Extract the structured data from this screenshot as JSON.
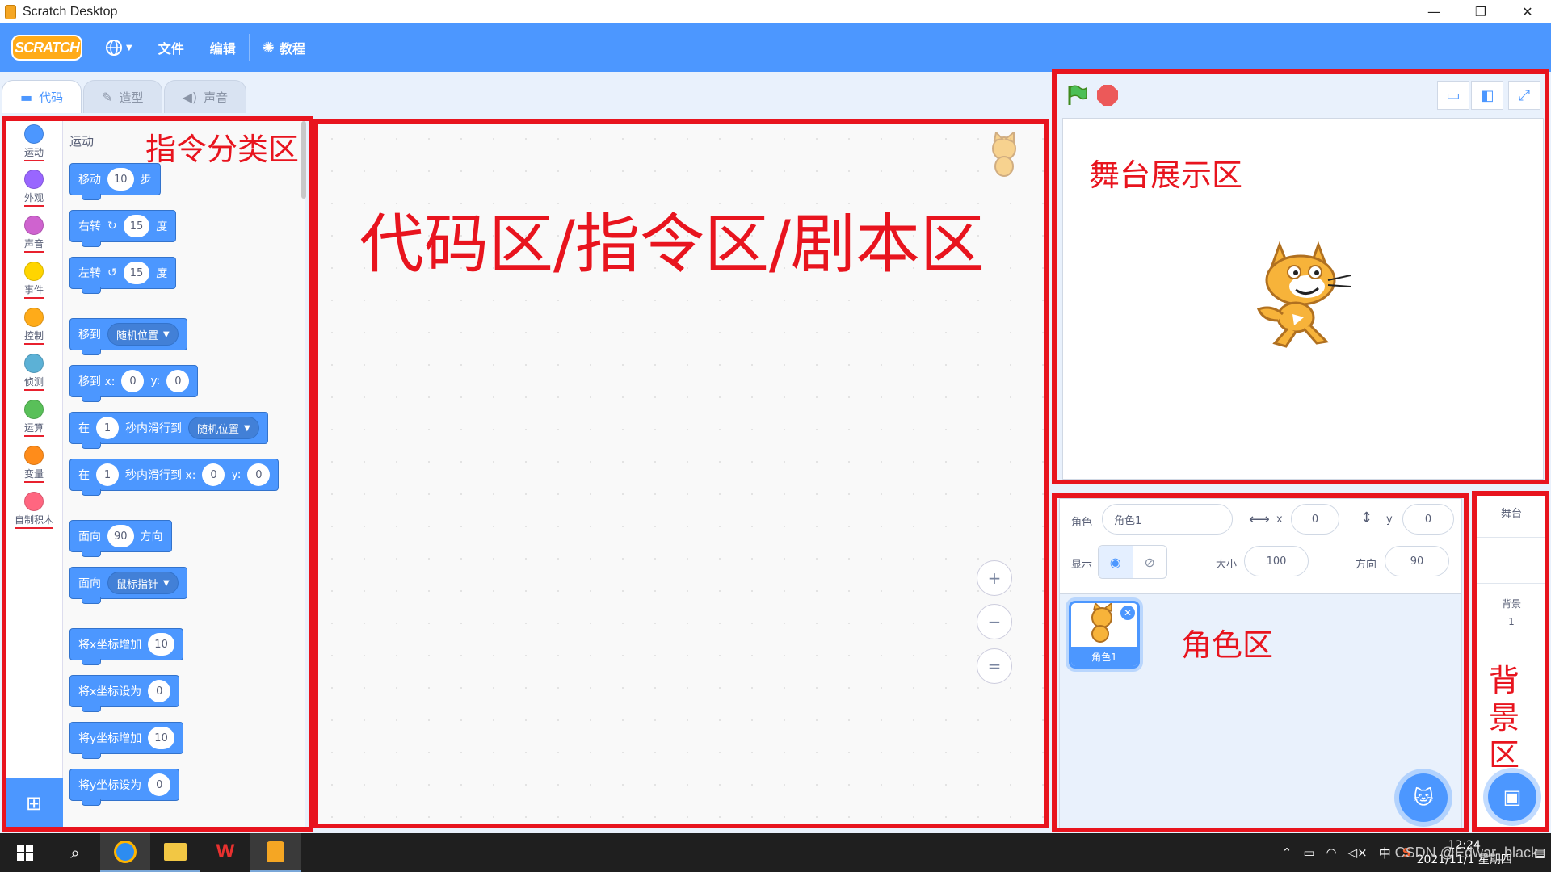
{
  "window": {
    "title": "Scratch Desktop",
    "minimize": "—",
    "maximize": "❐",
    "close": "✕"
  },
  "menubar": {
    "logo": "SCRATCH",
    "language_icon": "globe-icon",
    "file": "文件",
    "edit": "编辑",
    "tutorials": "教程"
  },
  "tabs": [
    {
      "label": "代码",
      "icon": "code-icon",
      "active": true
    },
    {
      "label": "造型",
      "icon": "brush-icon",
      "active": false
    },
    {
      "label": "声音",
      "icon": "speaker-icon",
      "active": false
    }
  ],
  "categories": [
    {
      "label": "运动",
      "color": "#4c97ff"
    },
    {
      "label": "外观",
      "color": "#9966ff"
    },
    {
      "label": "声音",
      "color": "#cf63cf"
    },
    {
      "label": "事件",
      "color": "#ffd500"
    },
    {
      "label": "控制",
      "color": "#ffab19"
    },
    {
      "label": "侦测",
      "color": "#5cb1d6"
    },
    {
      "label": "运算",
      "color": "#59c059"
    },
    {
      "label": "变量",
      "color": "#ff8c1a"
    },
    {
      "label": "自制积木",
      "color": "#ff6680"
    }
  ],
  "palette": {
    "section_title": "运动",
    "blocks": {
      "move": {
        "a": "移动",
        "v": "10",
        "b": "步"
      },
      "turn_right": {
        "a": "右转",
        "icon": "↻",
        "v": "15",
        "b": "度"
      },
      "turn_left": {
        "a": "左转",
        "icon": "↺",
        "v": "15",
        "b": "度"
      },
      "goto": {
        "a": "移到",
        "dd": "随机位置"
      },
      "goto_xy": {
        "a": "移到 x:",
        "x": "0",
        "b": "y:",
        "y": "0"
      },
      "glide": {
        "a": "在",
        "v": "1",
        "b": "秒内滑行到",
        "dd": "随机位置"
      },
      "glide_xy": {
        "a": "在",
        "v": "1",
        "b": "秒内滑行到 x:",
        "x": "0",
        "c": "y:",
        "y": "0"
      },
      "point": {
        "a": "面向",
        "v": "90",
        "b": "方向"
      },
      "point_towards": {
        "a": "面向",
        "dd": "鼠标指针"
      },
      "change_x": {
        "a": "将x坐标增加",
        "v": "10"
      },
      "set_x": {
        "a": "将x坐标设为",
        "v": "0"
      },
      "change_y": {
        "a": "将y坐标增加",
        "v": "10"
      },
      "set_y": {
        "a": "将y坐标设为",
        "v": "0"
      }
    }
  },
  "code_area": {
    "zoom_in": "+",
    "zoom_out": "−",
    "reset": "="
  },
  "sprite_info": {
    "sprite_label": "角色",
    "sprite_name": "角色1",
    "x_label": "x",
    "x_value": "0",
    "y_label": "y",
    "y_value": "0",
    "show_label": "显示",
    "size_label": "大小",
    "size_value": "100",
    "direction_label": "方向",
    "direction_value": "90"
  },
  "sprites": [
    {
      "name": "角色1",
      "selected": true
    }
  ],
  "backdrop": {
    "title": "舞台",
    "backdrops_label": "背景",
    "count": "1"
  },
  "annotations": {
    "categories": "指令分类区",
    "code": "代码区/指令区/剧本区",
    "stage": "舞台展示区",
    "sprites": "角色区",
    "backdrop_chars": [
      "背",
      "景",
      "区"
    ]
  },
  "taskbar": {
    "time": "12:24",
    "date": "2021/11/1 星期四",
    "ime": "中",
    "watermark": "CSDN @Edwar_black"
  }
}
